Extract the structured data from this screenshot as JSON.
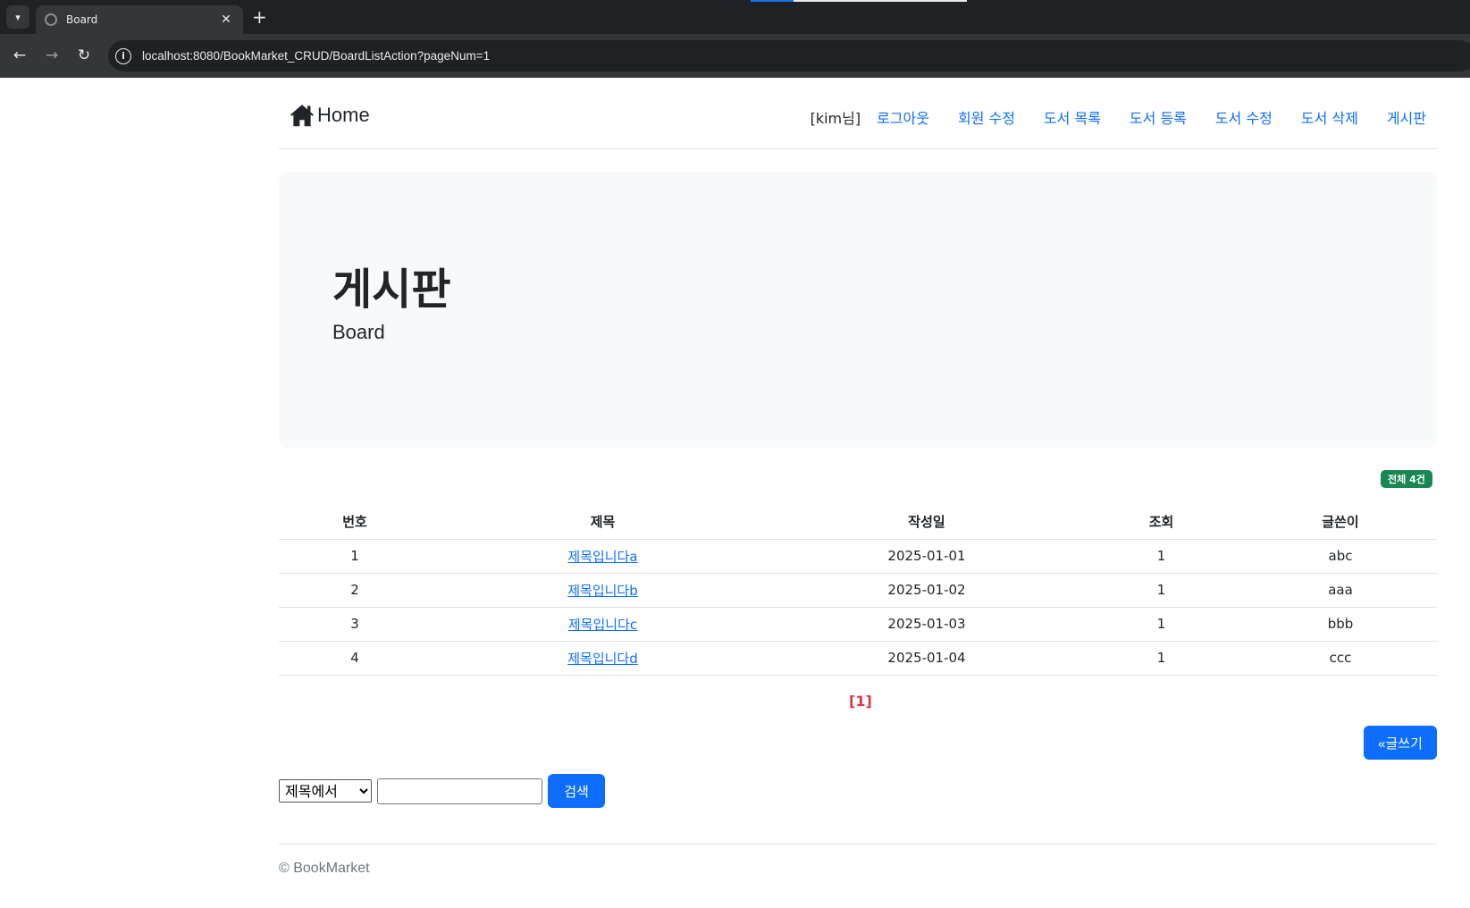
{
  "browser": {
    "tab_title": "Board",
    "url": "localhost:8080/BookMarket_CRUD/BoardListAction?pageNum=1"
  },
  "navbar": {
    "brand": "Home",
    "user_label": "[kim님]",
    "links": [
      "로그아웃",
      "회원 수정",
      "도서 목록",
      "도서 등록",
      "도서 수정",
      "도서 삭제",
      "게시판"
    ]
  },
  "jumbotron": {
    "title": "게시판",
    "subtitle": "Board"
  },
  "total_badge": "전체 4건",
  "table": {
    "headers": [
      "번호",
      "제목",
      "작성일",
      "조회",
      "글쓴이"
    ],
    "rows": [
      {
        "num": "1",
        "title": "제목입니다a",
        "date": "2025-01-01",
        "views": "1",
        "writer": "abc"
      },
      {
        "num": "2",
        "title": "제목입니다b",
        "date": "2025-01-02",
        "views": "1",
        "writer": "aaa"
      },
      {
        "num": "3",
        "title": "제목입니다c",
        "date": "2025-01-03",
        "views": "1",
        "writer": "bbb"
      },
      {
        "num": "4",
        "title": "제목입니다d",
        "date": "2025-01-04",
        "views": "1",
        "writer": "ccc"
      }
    ]
  },
  "pagination": {
    "current": "[1]"
  },
  "write_button": "«글쓰기",
  "search": {
    "selected_option": "제목에서",
    "input_value": "",
    "button": "검색"
  },
  "footer": "© BookMarket",
  "colors": {
    "primary": "#0d6efd",
    "success_badge": "#198754",
    "pagination_red": "#dc3545",
    "jumbotron_bg": "#f8f9fa"
  }
}
